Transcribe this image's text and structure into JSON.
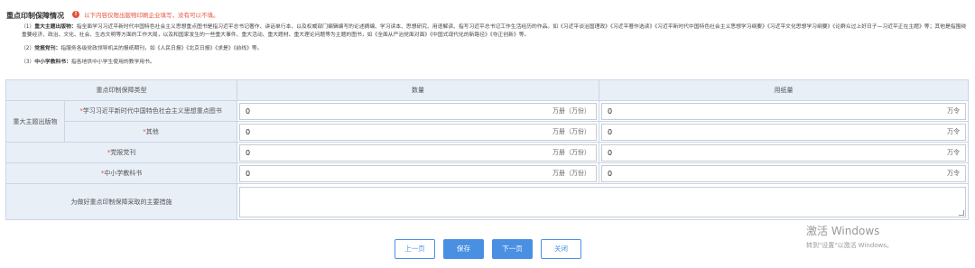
{
  "header": {
    "title": "重点印制保障情况",
    "warning_icon": "info-icon",
    "warning": "以下内容仅限出版物印刷企业填写，没有可以不填。"
  },
  "notes": [
    {
      "prefix": "（1）",
      "label": "重大主题出版物：",
      "text": "指全面学习习近平新时代中国特色社会主义思想重点图书是指习近平总书记著作、讲话单行本，以及权威部门编辑编写的论述摘编、学习读本、思想研究、用语解读、指写习近平总书记工作生活经历的作品。如《习近平谈治国理政》《习近平著作选读》《习近平新时代中国特色社会主义思想学习纲要》《习近平文化思想学习纲要》《论群众过上好日子—习近平正在主题》等；其他是指围绕重要经济、政治、文化、社会、生态文明等方面的工作大局，以及和国家发生的一些重大事件、重大活动、重大题材、重大理论问题等为主题的图书，如《全面从严治党面对面》《中国式现代化的新路径》《夺正创新》等。"
    },
    {
      "prefix": "（2）",
      "label": "党报党刊：",
      "text": "指服务各级党政领导机关的报纸期刊，如《人民日报》《北京日报》《求是》《前线》等。"
    },
    {
      "prefix": "（3）",
      "label": "中小学教科书：",
      "text": "指各地供中小学生使用的教学用书。"
    }
  ],
  "table": {
    "headers": [
      "重点印制保障类型",
      "数量",
      "用纸量"
    ],
    "group_label": "重大主题出版物",
    "rows": [
      {
        "label": "学习习近平新时代中国特色社会主义思想重点图书",
        "qty": "0",
        "qty_unit": "万册（万份）",
        "paper": "0",
        "paper_unit": "万令"
      },
      {
        "label": "其他",
        "qty": "0",
        "qty_unit": "万册（万份）",
        "paper": "0",
        "paper_unit": "万令"
      },
      {
        "label": "党报党刊",
        "qty": "0",
        "qty_unit": "万册（万份）",
        "paper": "0",
        "paper_unit": "万令"
      },
      {
        "label": "中小学教科书",
        "qty": "0",
        "qty_unit": "万册（万份）",
        "paper": "0",
        "paper_unit": "万令"
      }
    ],
    "measures_label": "为做好重点印制保障采取的主要措施",
    "measures_value": ""
  },
  "buttons": {
    "prev": "上一页",
    "save": "保存",
    "next": "下一页",
    "close": "关闭"
  },
  "watermark": {
    "line1": "激活 Windows",
    "line2": "转到\"设置\"以激活 Windows。"
  },
  "colors": {
    "accent": "#4a90e2",
    "warning": "#e8503a",
    "header_bg": "#e9eff7"
  }
}
